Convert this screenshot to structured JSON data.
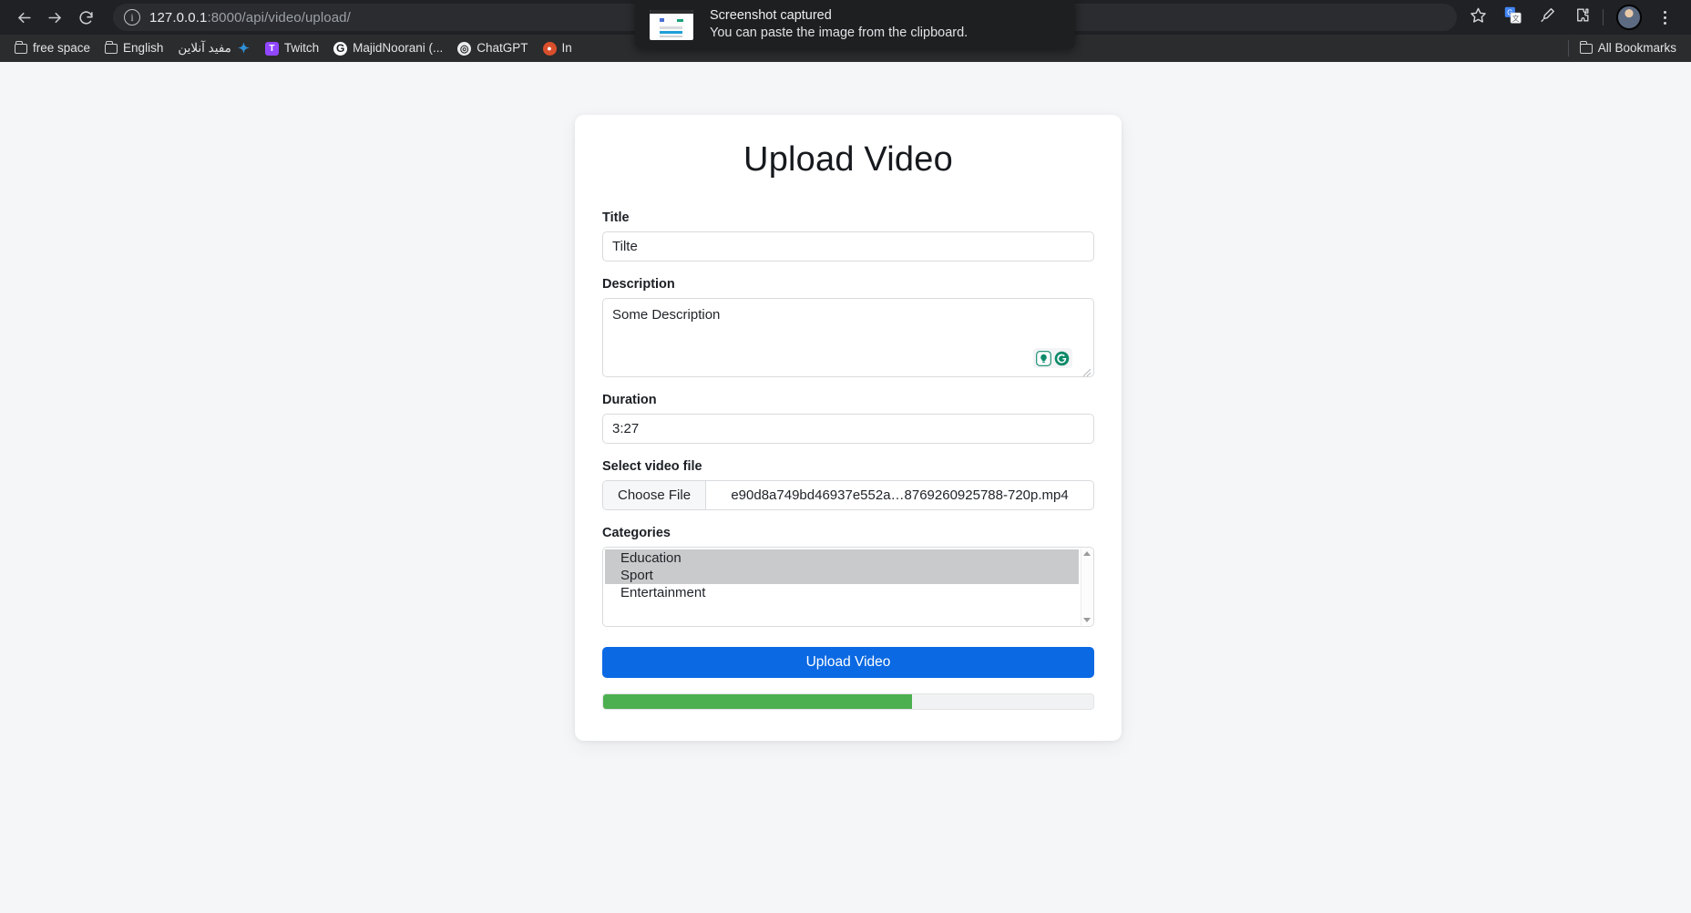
{
  "browser": {
    "url_host": "127.0.0.1",
    "url_rest": ":8000/api/video/upload/",
    "back_icon": "back-arrow-icon",
    "forward_icon": "forward-arrow-icon",
    "reload_icon": "reload-icon",
    "site_info_icon": "site-information-icon",
    "bookmark_star_icon": "bookmark-star-icon",
    "translate_icon": "google-translate-icon",
    "eyedropper_icon": "pencil-eyedropper-icon",
    "extensions_icon": "extensions-puzzle-icon",
    "profile_icon": "profile-avatar-icon",
    "menu_icon": "three-dot-menu-icon"
  },
  "bookmarks": {
    "items": [
      {
        "label": "free space",
        "icon": "folder-icon",
        "color": "#cdd0d4"
      },
      {
        "label": "English",
        "icon": "folder-icon",
        "color": "#cdd0d4"
      },
      {
        "label": "مفید آنلاین",
        "icon": "site-icon",
        "color": "#2f8fd6"
      },
      {
        "label": "Twitch",
        "icon": "twitch-icon",
        "color": "#9146ff"
      },
      {
        "label": "MajidNoorani (...",
        "icon": "github-icon",
        "color": "#ffffff"
      },
      {
        "label": "ChatGPT",
        "icon": "openai-icon",
        "color": "#f0f0f0"
      },
      {
        "label": "In",
        "icon": "site-icon",
        "color": "#d94f2b"
      }
    ],
    "all_bookmarks_label": "All Bookmarks",
    "all_bookmarks_icon": "folder-icon"
  },
  "toast": {
    "icon": "screenshot-thumbnail",
    "title": "Screenshot captured",
    "body": "You can paste the image from the clipboard."
  },
  "page": {
    "title": "Upload Video",
    "fields": {
      "title": {
        "label": "Title",
        "value": "Tilte",
        "placeholder": ""
      },
      "description": {
        "label": "Description",
        "value": "Some Description",
        "placeholder": ""
      },
      "duration": {
        "label": "Duration",
        "value": "3:27",
        "placeholder": ""
      },
      "video_file": {
        "label": "Select video file",
        "button_label": "Choose File",
        "file_name": "e90d8a749bd46937e552a…8769260925788-720p.mp4"
      },
      "categories": {
        "label": "Categories",
        "options": [
          {
            "label": "Education",
            "selected": true
          },
          {
            "label": "Sport",
            "selected": true
          },
          {
            "label": "Entertainment",
            "selected": false
          }
        ]
      }
    },
    "submit_label": "Upload Video",
    "progress": {
      "percent": 63,
      "color": "#4caf50"
    },
    "grammarly": {
      "assistant_icon": "grammarly-lightbulb-icon",
      "logo_icon": "grammarly-logo-icon",
      "color": "#0d8a6a"
    },
    "accent_color": "#0b69e3"
  }
}
